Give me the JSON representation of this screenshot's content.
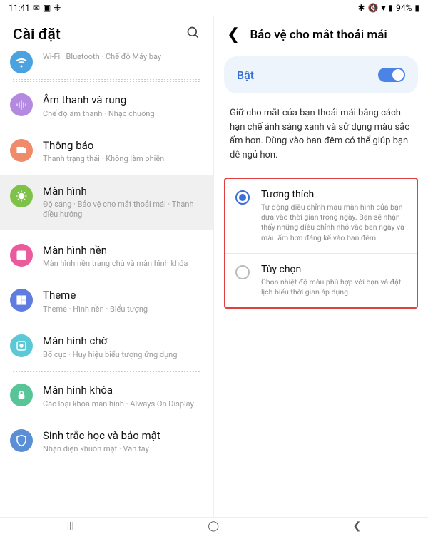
{
  "statusbar": {
    "time": "11:41",
    "battery": "94%"
  },
  "header": {
    "title": "Cài đặt"
  },
  "detail_header": {
    "title": "Bảo vệ cho mắt thoải mái"
  },
  "partial_top": {
    "sub": "Wi-Fi · Bluetooth · Chế độ Máy bay"
  },
  "items": [
    {
      "title": "Âm thanh và rung",
      "sub": "Chế độ âm thanh · Nhạc chuông",
      "color": "#b48ae0"
    },
    {
      "title": "Thông báo",
      "sub": "Thanh trạng thái · Không làm phiền",
      "color": "#ef8a6b"
    },
    {
      "title": "Màn hình",
      "sub": "Độ sáng · Bảo vệ cho mắt thoải mái · Thanh điều hướng",
      "color": "#7fc24a"
    },
    {
      "title": "Màn hình nền",
      "sub": "Màn hình nền trang chủ và màn hình khóa",
      "color": "#ea5a9c"
    },
    {
      "title": "Theme",
      "sub": "Theme · Hình nền · Biểu tượng",
      "color": "#5f7ce0"
    },
    {
      "title": "Màn hình chờ",
      "sub": "Bố cục · Huy hiệu biểu tượng ứng dụng",
      "color": "#5bc8d6"
    },
    {
      "title": "Màn hình khóa",
      "sub": "Các loại khóa màn hình · Always On Display",
      "color": "#58c498"
    },
    {
      "title": "Sinh trắc học và bảo mật",
      "sub": "Nhận diện khuôn mặt · Vân tay",
      "color": "#5a8fd6"
    }
  ],
  "toggle": {
    "label": "Bật"
  },
  "description": "Giữ cho mắt của bạn thoải mái bằng cách hạn chế ánh sáng xanh và sử dụng màu sắc ấm hơn. Dùng vào ban đêm có thể giúp bạn dễ ngủ hơn.",
  "radios": [
    {
      "title": "Tương thích",
      "sub": "Tự động điều chỉnh màu màn hình của bạn dựa vào thời gian trong ngày. Bạn sẽ nhận thấy những điều chỉnh nhỏ vào ban ngày và màu ấm hơn đáng kể vào ban đêm.",
      "checked": true
    },
    {
      "title": "Tùy chọn",
      "sub": "Chọn nhiệt độ màu phù hợp với bạn và đặt lịch biểu thời gian áp dụng.",
      "checked": false
    }
  ],
  "icon_colors": {
    "partial": "#4aa3df"
  }
}
